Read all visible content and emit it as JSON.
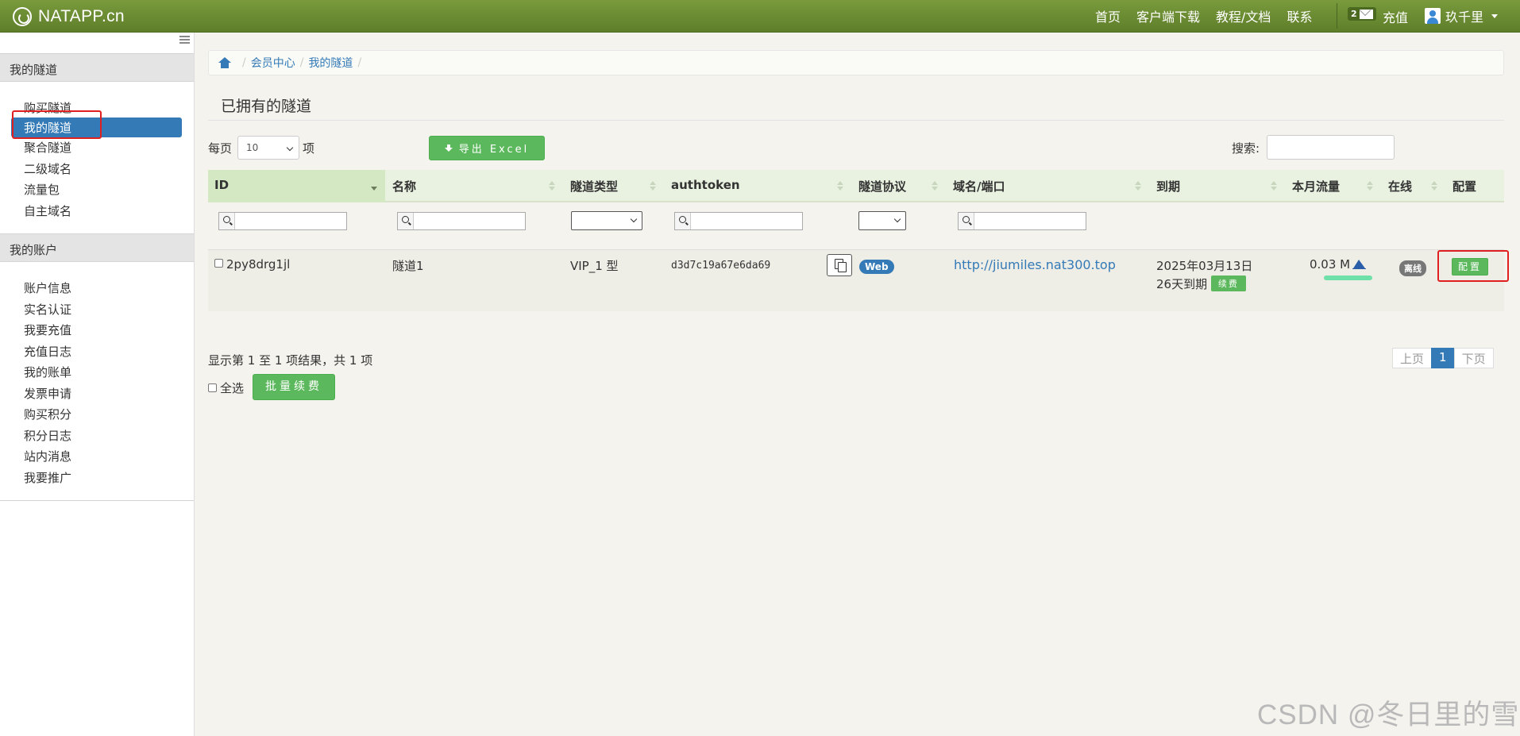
{
  "brand": {
    "name": "NATAPP.cn"
  },
  "topnav": {
    "links": [
      "首页",
      "客户端下载",
      "教程/文档",
      "联系"
    ],
    "message_count": "2",
    "recharge": "充值",
    "user_name": "玖千里"
  },
  "sidebar": {
    "section1_title": "我的隧道",
    "section1_items": [
      "购买隧道",
      "我的隧道",
      "聚合隧道",
      "二级域名",
      "流量包",
      "自主域名"
    ],
    "active_item": "我的隧道",
    "section2_title": "我的账户",
    "section2_items": [
      "账户信息",
      "实名认证",
      "我要充值",
      "充值日志",
      "我的账单",
      "发票申请",
      "购买积分",
      "积分日志",
      "站内消息",
      "我要推广"
    ]
  },
  "breadcrumb": [
    "会员中心",
    "我的隧道"
  ],
  "page": {
    "title": "已拥有的隧道",
    "per_page_label": "每页",
    "per_page_value": "10",
    "per_page_suffix": "项",
    "export_label": "导出 Excel",
    "search_label": "搜索:"
  },
  "table": {
    "columns": [
      "ID",
      "名称",
      "隧道类型",
      "authtoken",
      "隧道协议",
      "域名/端口",
      "到期",
      "本月流量",
      "在线",
      "配置"
    ],
    "rows": [
      {
        "id": "2py8drg1jl",
        "name": "隧道1",
        "type": "VIP_1 型",
        "authtoken": "d3d7c19a67e6da69",
        "protocol": "Web",
        "domain": "http://jiumiles.nat300.top",
        "expire_date": "2025年03月13日",
        "expire_days": "26天到期",
        "renew_label": "续费",
        "traffic": "0.03 M",
        "online": "离线",
        "config_label": "配置"
      }
    ]
  },
  "footer": {
    "result_info": "显示第 1 至 1 项结果，共 1 项",
    "select_all": "全选",
    "batch_renew": "批量续费",
    "pager": {
      "prev": "上页",
      "current": "1",
      "next": "下页"
    }
  },
  "watermark": "CSDN @冬日里的雪",
  "colors": {
    "nav": "#6b8b33",
    "primary": "#337ab7",
    "success": "#5cb85c",
    "highlight": "#e02020"
  }
}
